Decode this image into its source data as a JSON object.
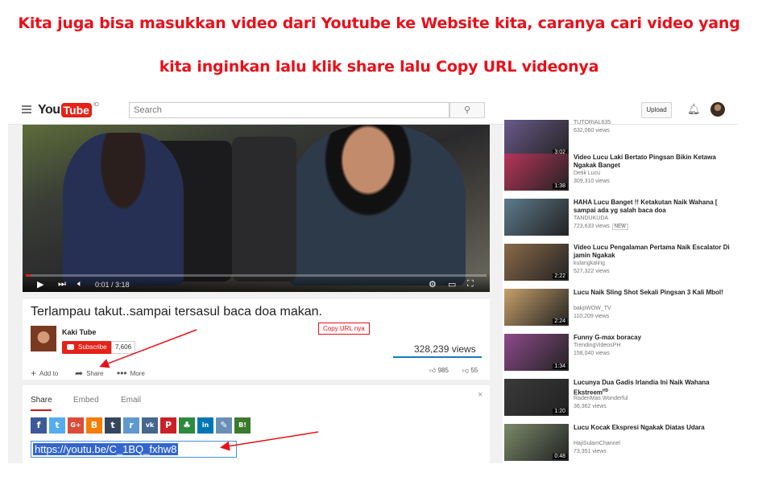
{
  "captions": {
    "line1": "Kita juga bisa masukkan video dari Youtube ke Website kita, caranya cari video yang",
    "line2": "kita inginkan lalu klik share lalu Copy URL videonya"
  },
  "header": {
    "logo_you": "You",
    "logo_tube": "Tube",
    "logo_region": "ID",
    "search_placeholder": "Search",
    "upload_label": "Upload"
  },
  "player": {
    "time": "0:01 / 3:18",
    "progress": 0.01
  },
  "video": {
    "title": "Terlampau takut..sampai tersasul baca doa makan.",
    "channel": "Kaki Tube",
    "subscribe_label": "Subscribe",
    "subscriber_count": "7,606",
    "views": "328,239 views",
    "add_to": "Add to",
    "share": "Share",
    "more": "More",
    "likes": "985",
    "dislikes": "55"
  },
  "share_panel": {
    "tabs": [
      "Share",
      "Embed",
      "Email"
    ],
    "close": "×",
    "url": "https://youtu.be/C_1BQ_fxhw8",
    "icons": [
      {
        "name": "facebook-icon",
        "glyph": "f",
        "color": "#3b5998"
      },
      {
        "name": "twitter-icon",
        "glyph": "t",
        "color": "#55acee"
      },
      {
        "name": "google-plus-icon",
        "glyph": "G+",
        "color": "#dd4b39"
      },
      {
        "name": "blogger-icon",
        "glyph": "B",
        "color": "#f57d00"
      },
      {
        "name": "tumblr-icon",
        "glyph": "t",
        "color": "#35465c"
      },
      {
        "name": "reddit-icon",
        "glyph": "r",
        "color": "#5f99cf"
      },
      {
        "name": "vk-icon",
        "glyph": "vk",
        "color": "#45668e"
      },
      {
        "name": "pinterest-icon",
        "glyph": "P",
        "color": "#cb2027"
      },
      {
        "name": "odnoklassniki-icon",
        "glyph": "♣",
        "color": "#2e8b3e"
      },
      {
        "name": "linkedin-icon",
        "glyph": "in",
        "color": "#0077b5"
      },
      {
        "name": "livejournal-icon",
        "glyph": "✎",
        "color": "#6a8fb5"
      },
      {
        "name": "hatena-icon",
        "glyph": "B!",
        "color": "#3c7a2e"
      }
    ]
  },
  "annotation": {
    "label": "Copy URL nya"
  },
  "sidebar": {
    "items": [
      {
        "title": "",
        "channel": "TUTORIAL635",
        "views": "632,060 views",
        "duration": "3:02",
        "color": "#6a5a8a"
      },
      {
        "title": "Video Lucu Laki Bertato Pingsan Bikin Ketawa Ngakak Banget",
        "channel": "Detik Lucu",
        "views": "309,310 views",
        "duration": "1:38",
        "color": "#b7355a"
      },
      {
        "title": "HAHA Lucu Banget !! Ketakutan Naik Wahana [ sampai ada yg salah baca doa",
        "channel": "TANDUKUDA",
        "views": "723,633 views",
        "duration": "",
        "badge": "NEW",
        "color": "#5e7b8c"
      },
      {
        "title": "Video Lucu Pengalaman Pertama Naik Escalator Di jamin Ngakak",
        "channel": "kulangkaling",
        "views": "527,322 views",
        "duration": "2:22",
        "color": "#8a6a4a"
      },
      {
        "title": "Lucu Naik Sling Shot Sekali Pingsan 3 Kali Mbol!",
        "channel": "bakpWOW_TV",
        "views": "110,209 views",
        "duration": "2:24",
        "color": "#c7a06a"
      },
      {
        "title": "Funny G-max boracay",
        "channel": "TrendingVideosPH",
        "views": "158,040 views",
        "duration": "1:34",
        "color": "#8e4a8a"
      },
      {
        "title": "Lucunya Dua Gadis Irlandia Ini Naik Wahana Ekstreem",
        "hd": "HD",
        "channel": "RadenMas Wonderful",
        "views": "36,362 views",
        "duration": "1:20",
        "color": "#3a3a3a"
      },
      {
        "title": "Lucu Kocak Ekspresi Ngakak Diatas Udara",
        "channel": "HajiSulamChannel",
        "views": "73,351 views",
        "duration": "0:48",
        "color": "#7a8a6a"
      }
    ]
  }
}
